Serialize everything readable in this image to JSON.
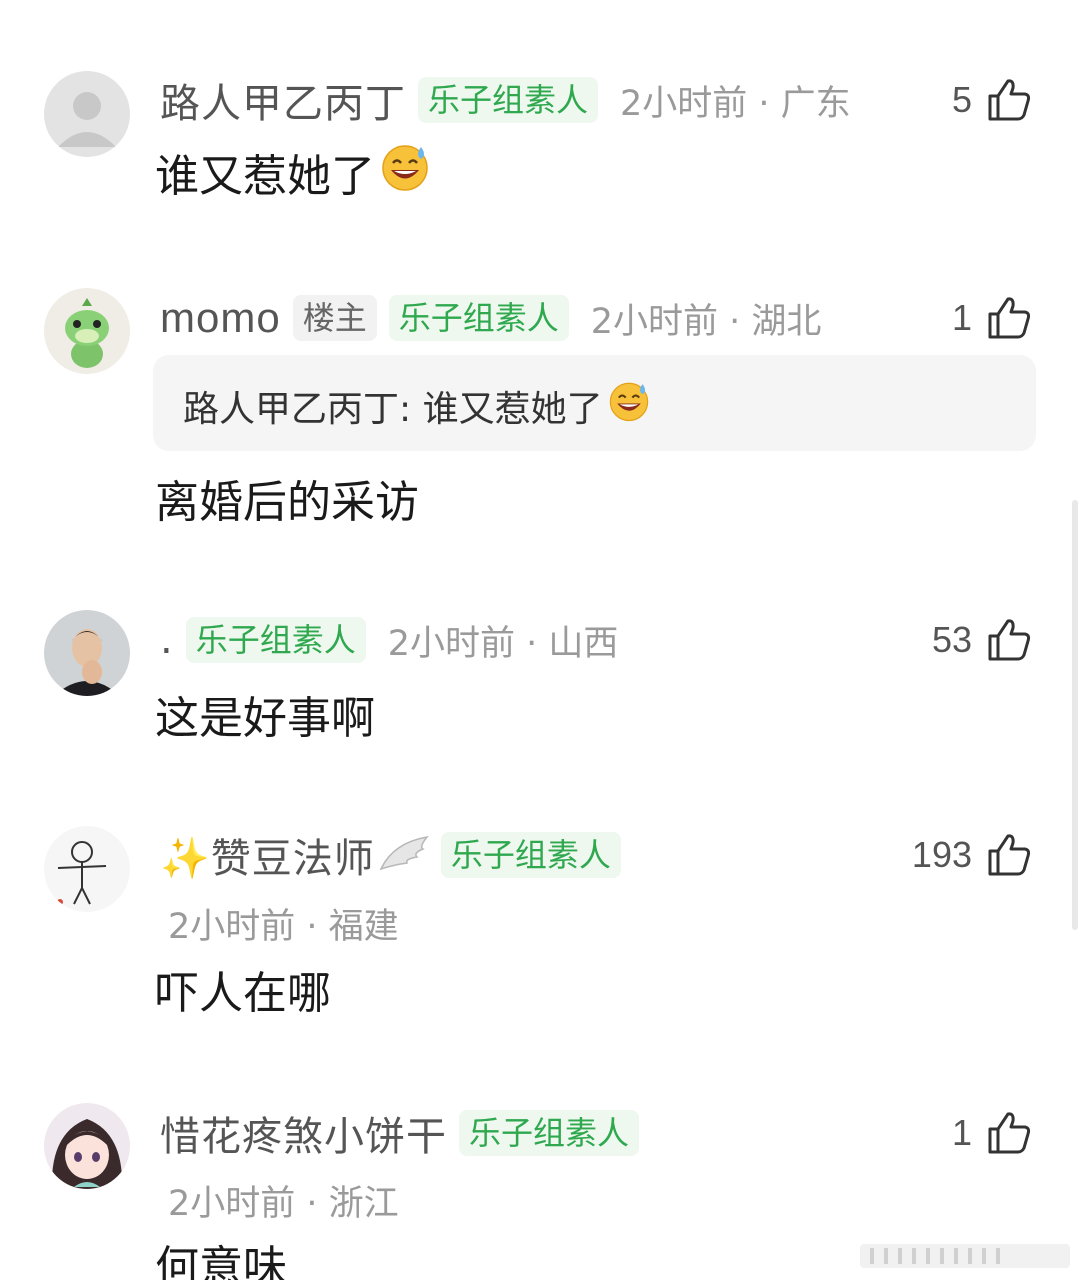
{
  "comments": [
    {
      "username": "路人甲乙丙丁",
      "badge": "乐子组素人",
      "time": "2小时前",
      "location": "广东",
      "meta": "2小时前 · 广东",
      "likes": "5",
      "text": "谁又惹她了",
      "emoji": "sweat-smile-emoji"
    },
    {
      "username": "momo",
      "owner_badge": "楼主",
      "badge": "乐子组素人",
      "meta": "2小时前 · 湖北",
      "likes": "1",
      "quote_text": "路人甲乙丙丁: 谁又惹她了",
      "emoji": "sweat-smile-emoji",
      "text": "离婚后的采访"
    },
    {
      "username": ".",
      "badge": "乐子组素人",
      "meta": "2小时前 · 山西",
      "likes": "53",
      "text": "这是好事啊"
    },
    {
      "username": "✨赞豆法师",
      "badge": "乐子组素人",
      "meta": "2小时前 · 福建",
      "likes": "193",
      "text": "吓人在哪"
    },
    {
      "username": "惜花疼煞小饼干",
      "badge": "乐子组素人",
      "meta": "2小时前 · 浙江",
      "likes": "1",
      "text": "何意味"
    }
  ],
  "colors": {
    "badge_green": "#2fa84f",
    "badge_bg": "#eef8ee",
    "meta_gray": "#9a9a9a"
  },
  "icons": [
    "thumbs-up-icon",
    "sweat-smile-emoji",
    "wing-icon",
    "sparkles-icon"
  ]
}
